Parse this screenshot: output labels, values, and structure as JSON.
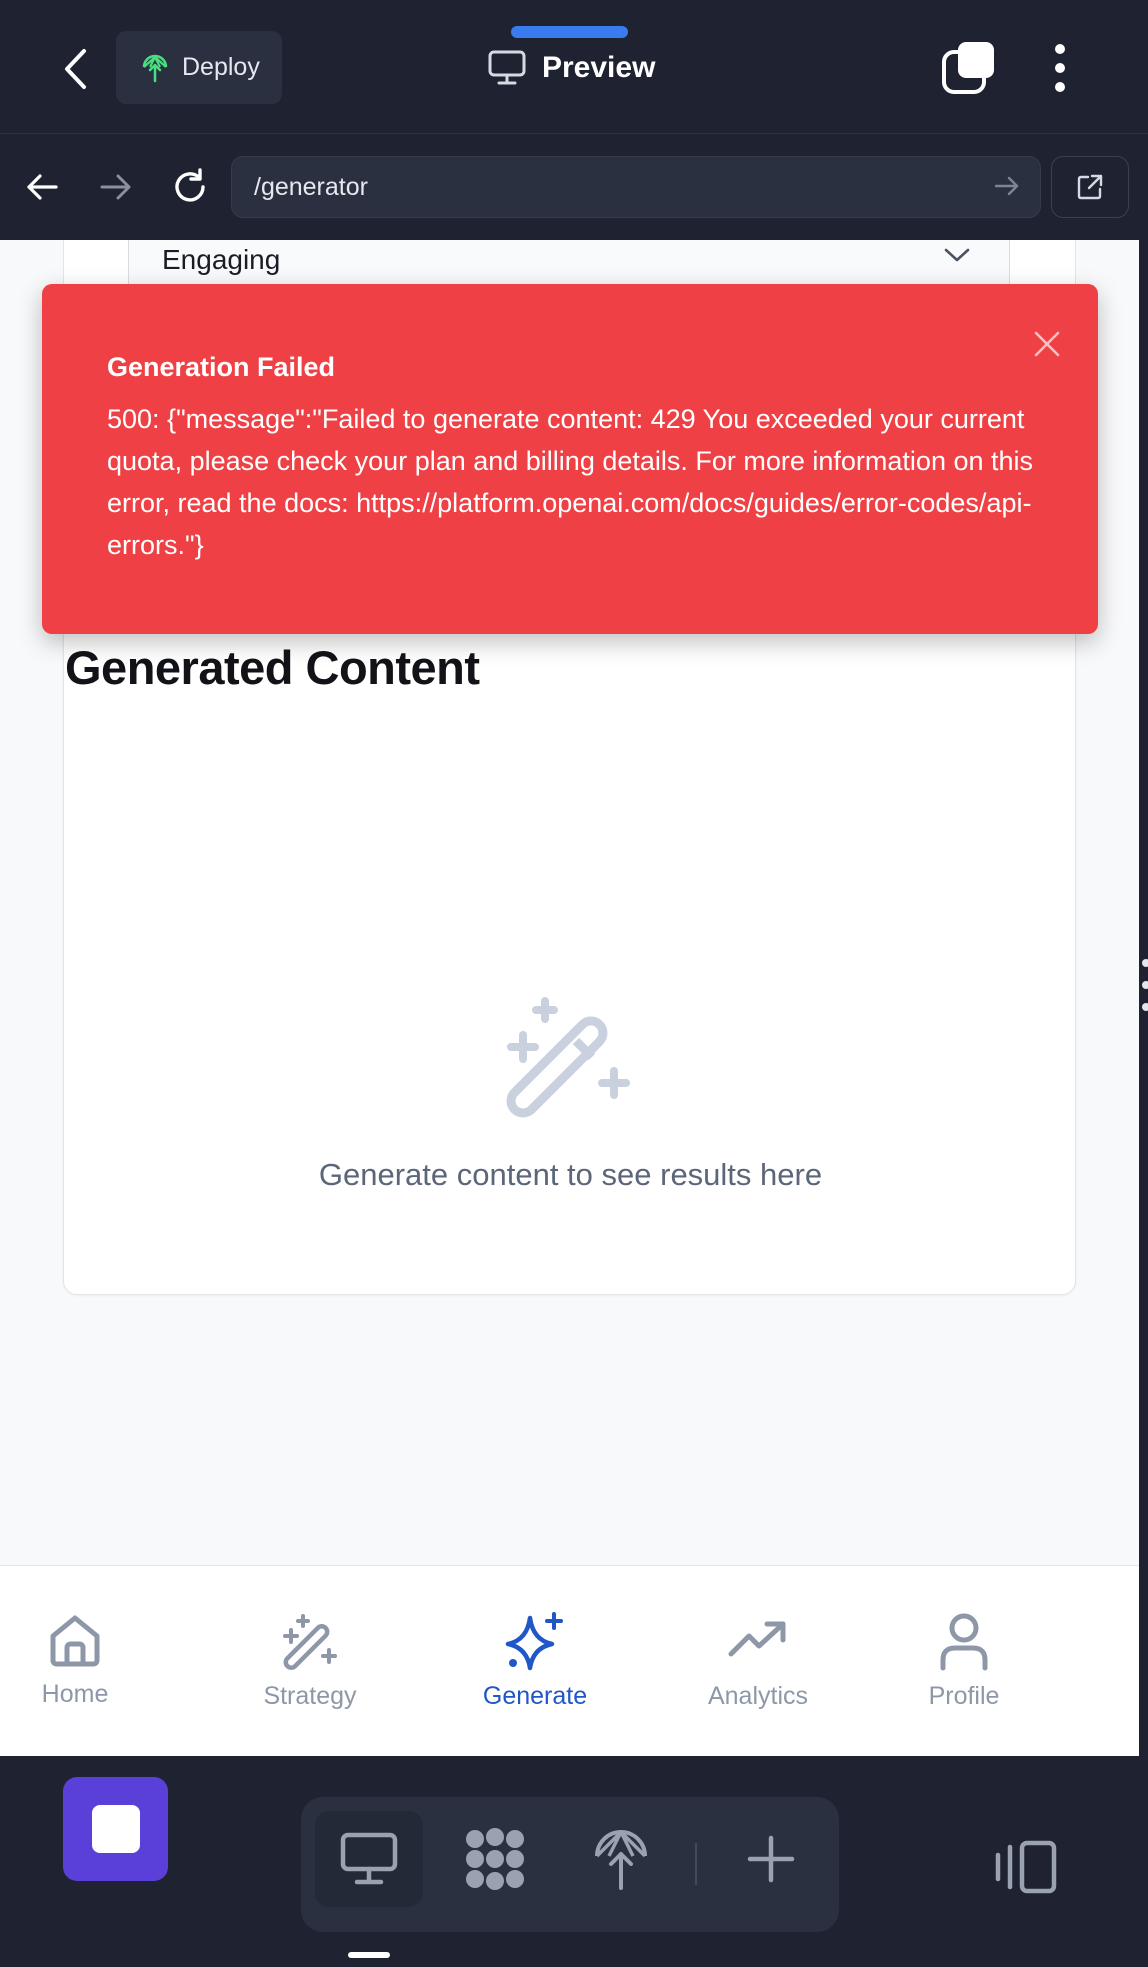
{
  "topbar": {
    "deploy_label": "Deploy",
    "title": "Preview"
  },
  "address_bar": {
    "url": "/generator"
  },
  "form": {
    "tone_value": "Engaging"
  },
  "toast": {
    "title": "Generation Failed",
    "message": "500: {\"message\":\"Failed to generate content: 429 You exceeded your current quota, please check your plan and billing details. For more information on this error, read the docs: https://platform.openai.com/docs/guides/error-codes/api-errors.\"}"
  },
  "content": {
    "title": "Generated Content",
    "empty_text": "Generate content to see results here"
  },
  "bottom_nav": {
    "items": [
      {
        "label": "Home",
        "icon": "home-icon",
        "active": false
      },
      {
        "label": "Strategy",
        "icon": "magic-wand-icon",
        "active": false
      },
      {
        "label": "Generate",
        "icon": "sparkle-icon",
        "active": true
      },
      {
        "label": "Analytics",
        "icon": "trending-up-icon",
        "active": false
      },
      {
        "label": "Profile",
        "icon": "user-icon",
        "active": false
      }
    ]
  },
  "colors": {
    "dark_bg": "#1e2231",
    "toast_red": "#ef4145",
    "active_blue": "#2056c8",
    "inactive_gray": "#8d97a8",
    "stop_purple": "#5a3fd9",
    "deploy_green": "#4ade80"
  }
}
